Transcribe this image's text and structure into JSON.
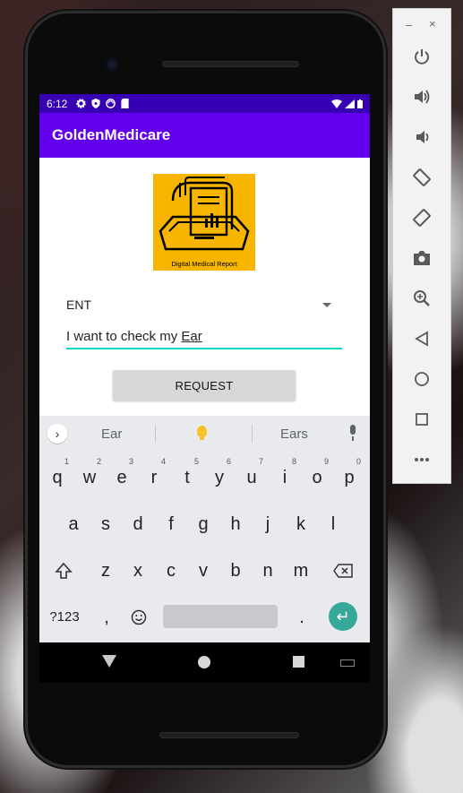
{
  "status_bar": {
    "time": "6:12"
  },
  "app_bar": {
    "title": "GoldenMedicare"
  },
  "logo": {
    "caption": "Digital Medical Report"
  },
  "form": {
    "spinner_value": "ENT",
    "input_prefix": "I want to check my ",
    "input_current_word": "Ear",
    "request_label": "REQUEST"
  },
  "keyboard": {
    "suggestions": [
      "Ear",
      "Ears"
    ],
    "row1": [
      {
        "k": "q",
        "h": "1"
      },
      {
        "k": "w",
        "h": "2"
      },
      {
        "k": "e",
        "h": "3"
      },
      {
        "k": "r",
        "h": "4"
      },
      {
        "k": "t",
        "h": "5"
      },
      {
        "k": "y",
        "h": "6"
      },
      {
        "k": "u",
        "h": "7"
      },
      {
        "k": "i",
        "h": "8"
      },
      {
        "k": "o",
        "h": "9"
      },
      {
        "k": "p",
        "h": "0"
      }
    ],
    "row2": [
      "a",
      "s",
      "d",
      "f",
      "g",
      "h",
      "j",
      "k",
      "l"
    ],
    "row3": [
      "z",
      "x",
      "c",
      "v",
      "b",
      "n",
      "m"
    ],
    "symbols_label": "?123",
    "comma": ",",
    "period": "."
  },
  "colors": {
    "status_bar": "#3700b3",
    "app_bar": "#6200ee",
    "accent": "#03dac5",
    "enter_key": "#36a89a",
    "logo_bg": "#f7b500"
  },
  "emulator_panel": {
    "window_min": "–",
    "window_close": "×",
    "tools": [
      "power-icon",
      "volume-up-icon",
      "volume-down-icon",
      "rotate-left-icon",
      "rotate-right-icon",
      "camera-icon",
      "zoom-icon",
      "back-icon",
      "home-icon",
      "overview-icon",
      "more-icon"
    ]
  }
}
